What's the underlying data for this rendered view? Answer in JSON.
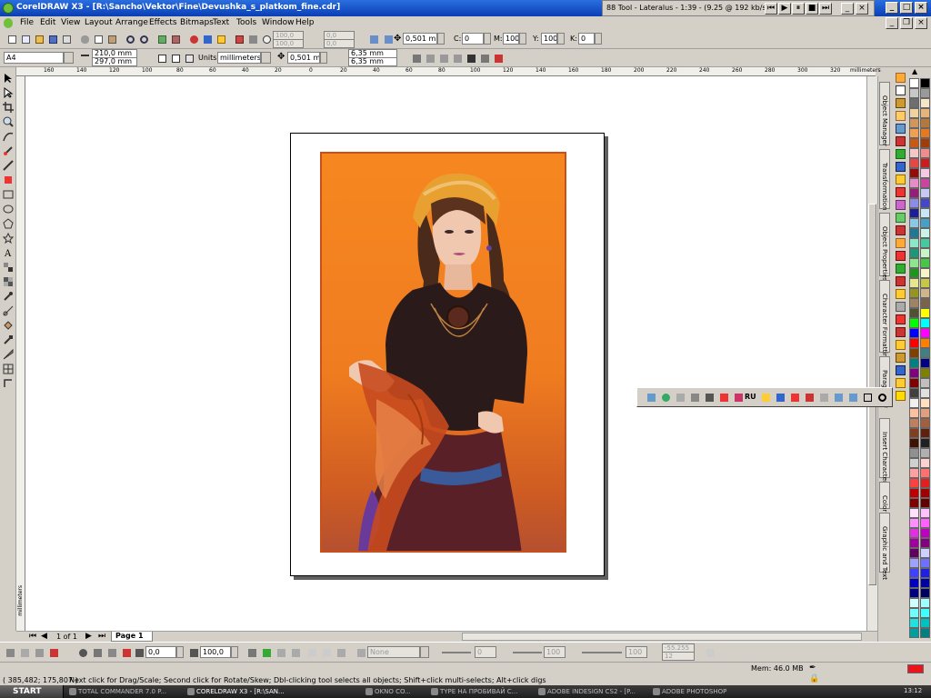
{
  "window": {
    "title": "CorelDRAW X3 - [R:\\Sancho\\Vektor\\Fine\\Devushka_s_platkom_fine.cdr]",
    "winamp_title": "88 Tool - Lateralus - 1:39 - (9.25 @ 192 kb/s)"
  },
  "menu": [
    "File",
    "Edit",
    "View",
    "Layout",
    "Arrange",
    "Effects",
    "Bitmaps",
    "Text",
    "Tools",
    "Window",
    "Help"
  ],
  "standard_toolbar": {
    "scale_x": "100,0",
    "scale_y": "100,0",
    "rotation_1": "0,0",
    "rotation_2": "0,0",
    "outline_width": "0,501 mm",
    "cmyk": {
      "c_label": "C:",
      "c": "0",
      "m_label": "M:",
      "m": "100",
      "y_label": "Y:",
      "y": "100",
      "k_label": "K:",
      "k": "0"
    }
  },
  "property_bar": {
    "paper_size": "A4",
    "width": "210,0 mm",
    "height": "297,0 mm",
    "units_label": "Units:",
    "units": "millimeters",
    "nudge": "0,501 mm",
    "dup_x": "6,35 mm",
    "dup_y": "6,35 mm"
  },
  "ruler": {
    "h_labels": [
      "160",
      "140",
      "120",
      "100",
      "80",
      "60",
      "40",
      "20",
      "0",
      "20",
      "40",
      "60",
      "80",
      "100",
      "120",
      "140",
      "160",
      "180",
      "200",
      "220",
      "240",
      "260",
      "280",
      "300",
      "320",
      "340"
    ],
    "units": "millimeters",
    "v_units": "millimeters"
  },
  "page_nav": {
    "pages": "1 of 1",
    "tab": "Page 1"
  },
  "bottom_bar": {
    "blend_value": "0,0",
    "opacity_value": "100,0",
    "fill_select": "None",
    "field_a": "0",
    "field_b": "100",
    "field_c": "100",
    "range_a": "-55.255",
    "range_b": "12"
  },
  "status": {
    "coordinates": "( 385,482; 175,807 )",
    "hint": "Next click for Drag/Scale; Second click for Rotate/Skew; Dbl-clicking tool selects all objects; Shift+click multi-selects; Alt+click digs",
    "memory": "Mem: 46.0 MB"
  },
  "dockers": [
    "Object Manager",
    "Transformation",
    "Object Properties",
    "Character Formatting",
    "Paragraph F",
    "Insert Character",
    "Color",
    "Graphic and Text"
  ],
  "floatbar": {
    "lang": "RU"
  },
  "taskbar": {
    "start": "START",
    "tasks": [
      "TOTAL COMMANDER 7.0 P...",
      "CORELDRAW X3 - [R:\\SAN...",
      "OKNO CO...",
      "TYPE HA ПРОБИВАЙ С...",
      "ADOBE INDESIGN CS2 - [P...",
      "ADOBE PHOTOSHOP"
    ],
    "clock": "13:12"
  },
  "colors": {
    "accent_fill": "#e8141e",
    "palette": [
      "#ffffff",
      "#000000",
      "#c8c8c8",
      "#9a9a9a",
      "#6e6e6e",
      "#f5e6c8",
      "#f0d2a0",
      "#e6b478",
      "#d2965a",
      "#b4783c",
      "#f0a050",
      "#e6781e",
      "#c85a14",
      "#a03c0a",
      "#f5c8c8",
      "#f08c8c",
      "#e64646",
      "#c81e1e",
      "#960a0a",
      "#f5c8e6",
      "#e68cc8",
      "#c846a0",
      "#961e78",
      "#c8c8f5",
      "#8c8ce6",
      "#4646c8",
      "#1e1e96",
      "#c8e6f5",
      "#8cc8e6",
      "#46a0c8",
      "#1e7896",
      "#c8f5e6",
      "#8ce6c8",
      "#46c8a0",
      "#1e9678",
      "#c8f5c8",
      "#8ce68c",
      "#46c846",
      "#1e961e",
      "#f5f5c8",
      "#e6e68c",
      "#c8c846",
      "#96961e",
      "#d2b48c",
      "#a08264",
      "#78644b",
      "#505032",
      "#ffff00",
      "#00ff00",
      "#00ffff",
      "#0000ff",
      "#ff00ff",
      "#ff0000",
      "#ff8000",
      "#804000",
      "#408080",
      "#008080",
      "#000080",
      "#800080",
      "#808000",
      "#800000",
      "#c0c0c0",
      "#404040",
      "#e0e0e0",
      "#f0f0f0",
      "#ffe0c0",
      "#ffc0a0",
      "#e0a080",
      "#c08060",
      "#a06040",
      "#804020",
      "#602010",
      "#401000",
      "#202020",
      "#909090",
      "#b0b0b0",
      "#d0d0d0",
      "#ffd0d0",
      "#ffa0a0",
      "#ff7070",
      "#ff4040",
      "#e02020",
      "#c00000",
      "#a00000",
      "#800000",
      "#600000",
      "#ffe0ff",
      "#ffc0ff",
      "#ff90ff",
      "#ff60ff",
      "#e030e0",
      "#c000c0",
      "#a000a0",
      "#800080",
      "#600060",
      "#d0d0ff",
      "#a0a0ff",
      "#7070ff",
      "#4040ff",
      "#2020e0",
      "#0000c0",
      "#0000a0",
      "#000080",
      "#000060",
      "#d0ffff",
      "#a0ffff",
      "#70ffff",
      "#40ffff",
      "#20e0e0",
      "#00c0c0",
      "#00a0a0",
      "#008080",
      "#006060",
      "#d0ffd0",
      "#a0ffa0",
      "#70ff70",
      "#40ff40",
      "#20e020",
      "#00c000",
      "#00a000",
      "#008000",
      "#006000"
    ]
  }
}
